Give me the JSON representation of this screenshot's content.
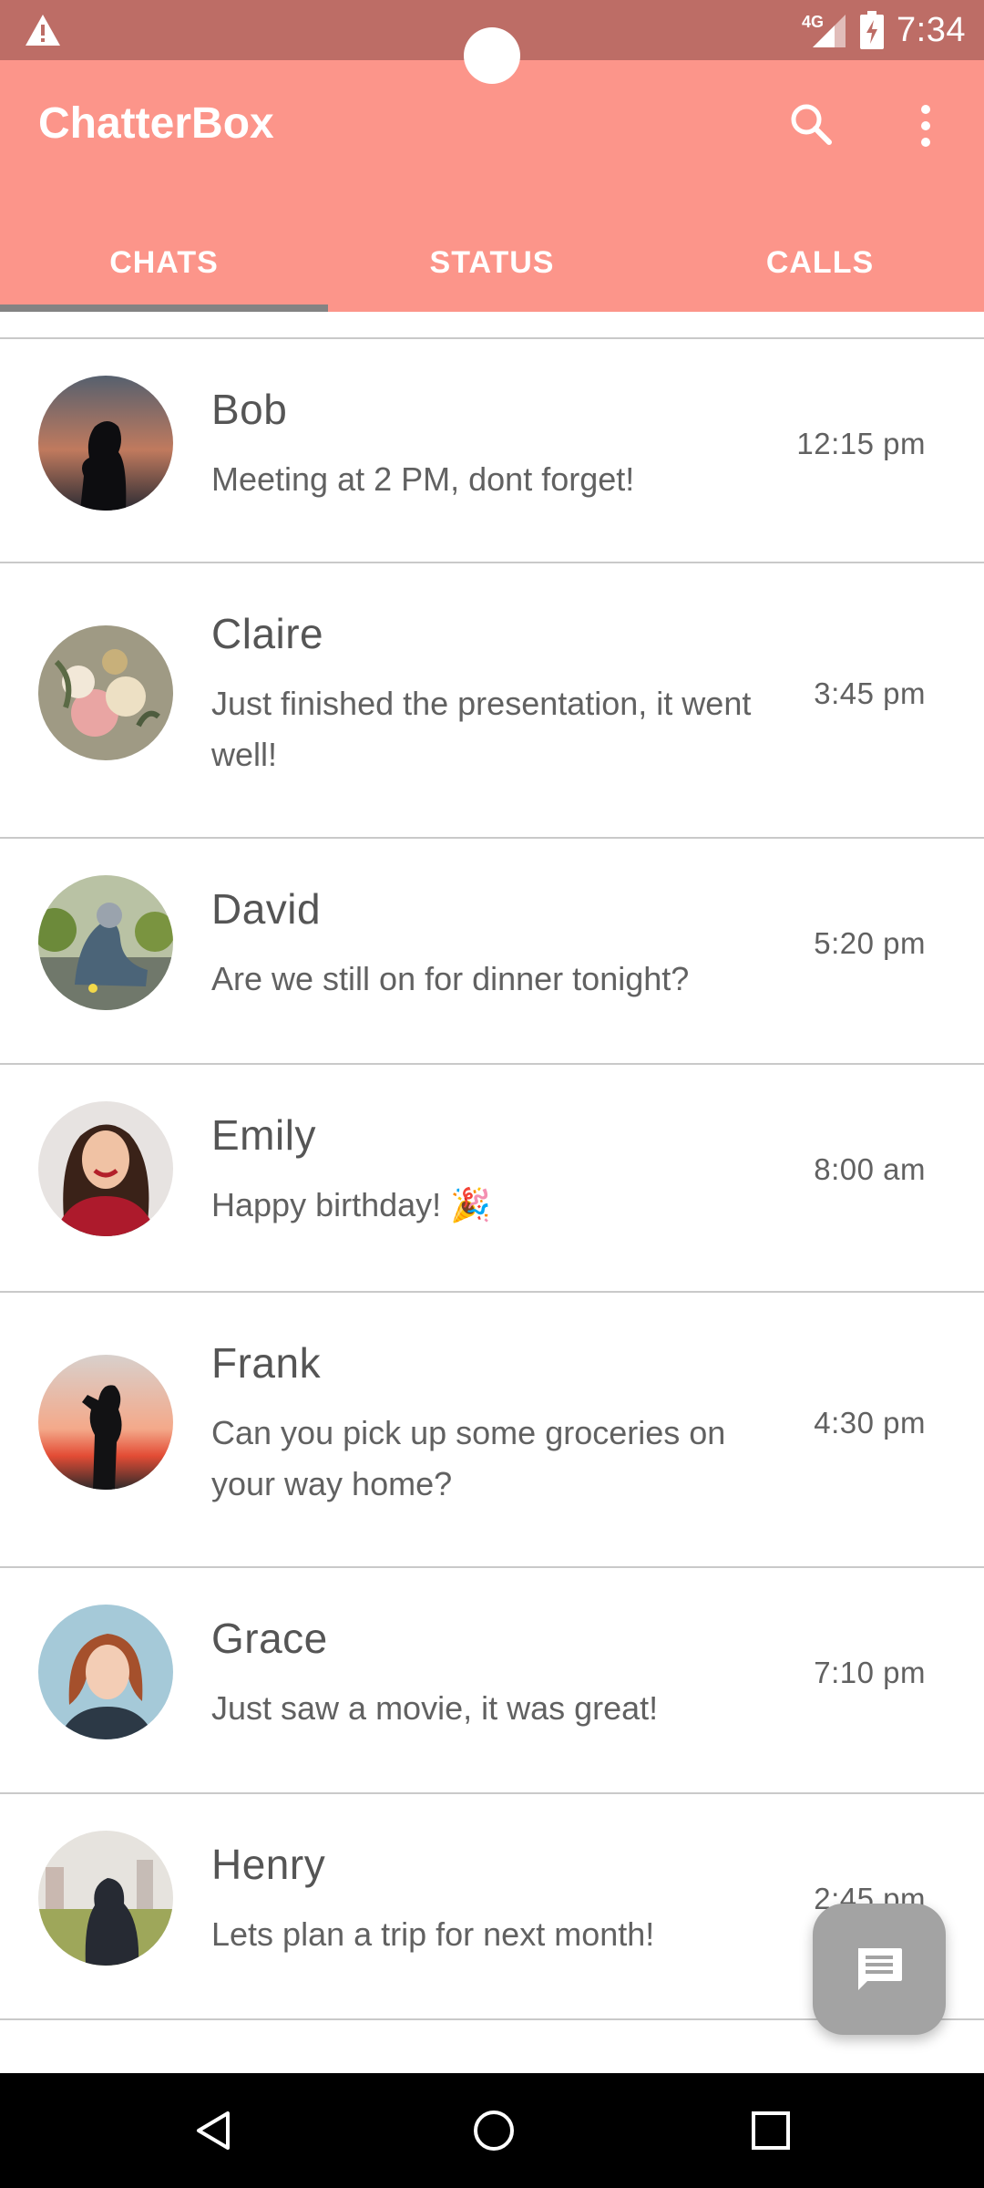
{
  "status_bar": {
    "time": "7:34",
    "network": "4G",
    "icons": [
      "warning-icon",
      "signal-icon",
      "battery-charging-icon"
    ]
  },
  "app_bar": {
    "title": "ChatterBox",
    "icons": [
      "search-icon",
      "more-vert-icon"
    ],
    "colors": {
      "bar": "#fc958a",
      "status": "#bd6d66"
    }
  },
  "tabs": [
    {
      "label": "CHATS",
      "selected": true
    },
    {
      "label": "STATUS",
      "selected": false
    },
    {
      "label": "CALLS",
      "selected": false
    }
  ],
  "chats": [
    {
      "name": "Bob",
      "message": "Meeting at 2 PM, dont forget!",
      "time": "12:15 pm",
      "avatar": "silhouette-sunset"
    },
    {
      "name": "Claire",
      "message": "Just finished the presentation, it went well!",
      "time": "3:45 pm",
      "avatar": "flowers"
    },
    {
      "name": "David",
      "message": "Are we still on for dinner tonight?",
      "time": "5:20 pm",
      "avatar": "hooded-person-sitting"
    },
    {
      "name": "Emily",
      "message": "Happy birthday! 🎉",
      "time": "8:00 am",
      "avatar": "smiling-woman"
    },
    {
      "name": "Frank",
      "message": "Can you pick up some groceries on your way home?",
      "time": "4:30 pm",
      "avatar": "photographer-silhouette"
    },
    {
      "name": "Grace",
      "message": "Just saw a movie, it was great!",
      "time": "7:10 pm",
      "avatar": "red-hair-woman"
    },
    {
      "name": "Henry",
      "message": "Lets plan a trip for next month!",
      "time": "2:45 pm",
      "avatar": "hooded-man-field"
    }
  ],
  "fab": {
    "icon": "message-icon"
  },
  "nav_bar": {
    "icons": [
      "back-icon",
      "home-icon",
      "recents-icon"
    ]
  }
}
